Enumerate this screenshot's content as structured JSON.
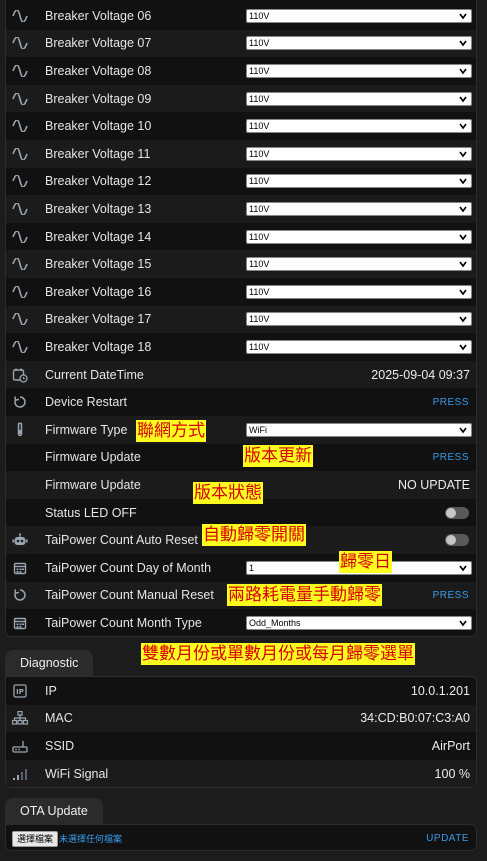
{
  "rows": [
    {
      "label": "Breaker Voltage 06",
      "select": "110V"
    },
    {
      "label": "Breaker Voltage 07",
      "select": "110V"
    },
    {
      "label": "Breaker Voltage 08",
      "select": "110V"
    },
    {
      "label": "Breaker Voltage 09",
      "select": "110V"
    },
    {
      "label": "Breaker Voltage 10",
      "select": "110V"
    },
    {
      "label": "Breaker Voltage 11",
      "select": "110V"
    },
    {
      "label": "Breaker Voltage 12",
      "select": "110V"
    },
    {
      "label": "Breaker Voltage 13",
      "select": "110V"
    },
    {
      "label": "Breaker Voltage 14",
      "select": "110V"
    },
    {
      "label": "Breaker Voltage 15",
      "select": "110V"
    },
    {
      "label": "Breaker Voltage 16",
      "select": "110V"
    },
    {
      "label": "Breaker Voltage 17",
      "select": "110V"
    },
    {
      "label": "Breaker Voltage 18",
      "select": "110V"
    },
    {
      "label": "Current DateTime",
      "value": "2025-09-04 09:37"
    },
    {
      "label": "Device Restart",
      "button": "PRESS"
    },
    {
      "label": "Firmware Type",
      "select": "WiFi"
    },
    {
      "label": "Firmware Update",
      "button": "PRESS"
    },
    {
      "label": "Firmware Update",
      "value": "NO UPDATE"
    },
    {
      "label": "Status LED OFF",
      "toggle": "off"
    },
    {
      "label": "TaiPower Count Auto Reset",
      "toggle": "off"
    },
    {
      "label": "TaiPower Count Day of Month",
      "select": "1"
    },
    {
      "label": "TaiPower Count Manual Reset",
      "button": "PRESS"
    },
    {
      "label": "TaiPower Count Month Type",
      "select": "Odd_Months"
    }
  ],
  "annotations": {
    "network_mode": "聯網方式",
    "firmware_update": "版本更新",
    "firmware_status": "版本狀態",
    "auto_reset_switch": "自動歸零開關",
    "reset_day": "歸零日",
    "manual_reset": "兩路耗電量手動歸零",
    "month_type": "雙數月份或單數月份或每月歸零選單"
  },
  "diagnostic": {
    "tab_label": "Diagnostic",
    "rows": [
      {
        "label": "IP",
        "value": "10.0.1.201"
      },
      {
        "label": "MAC",
        "value": "34:CD:B0:07:C3:A0"
      },
      {
        "label": "SSID",
        "value": "AirPort"
      },
      {
        "label": "WiFi Signal",
        "value": "100 %"
      }
    ]
  },
  "ota": {
    "tab_label": "OTA Update",
    "choose_file": "選擇檔案",
    "no_file": "未選擇任何檔案",
    "update": "UPDATE"
  },
  "colors": {
    "accent": "#3b9be8",
    "annotation_bg": "#ffff1f",
    "annotation_text": "#d80000"
  }
}
